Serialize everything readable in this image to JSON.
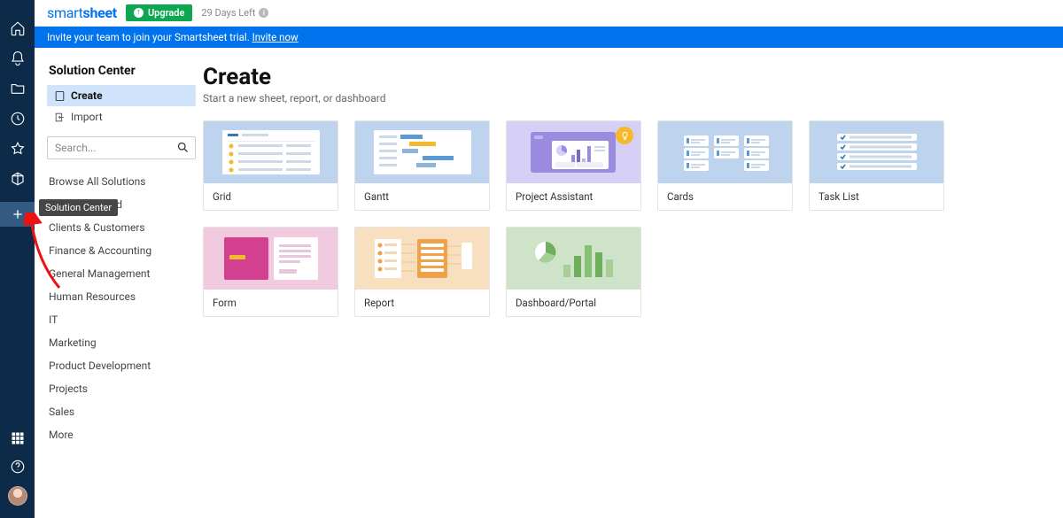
{
  "rail": {
    "tooltip": "Solution Center"
  },
  "header": {
    "logo_a": "smart",
    "logo_b": "sheet",
    "upgrade": "Upgrade",
    "days_left": "29 Days Left"
  },
  "banner": {
    "text": "Invite your team to join your Smartsheet trial. ",
    "link": "Invite now"
  },
  "sidebar": {
    "title": "Solution Center",
    "items": [
      {
        "label": "Create"
      },
      {
        "label": "Import"
      }
    ],
    "search_placeholder": "Search...",
    "categories": [
      "Browse All Solutions",
      "Recently Added",
      "Clients & Customers",
      "Finance & Accounting",
      "General Management",
      "Human Resources",
      "IT",
      "Marketing",
      "Product Development",
      "Projects",
      "Sales",
      "More"
    ]
  },
  "page": {
    "title": "Create",
    "subtitle": "Start a new sheet, report, or dashboard",
    "cards": [
      {
        "label": "Grid"
      },
      {
        "label": "Gantt"
      },
      {
        "label": "Project Assistant"
      },
      {
        "label": "Cards"
      },
      {
        "label": "Task List"
      },
      {
        "label": "Form"
      },
      {
        "label": "Report"
      },
      {
        "label": "Dashboard/Portal"
      }
    ]
  }
}
